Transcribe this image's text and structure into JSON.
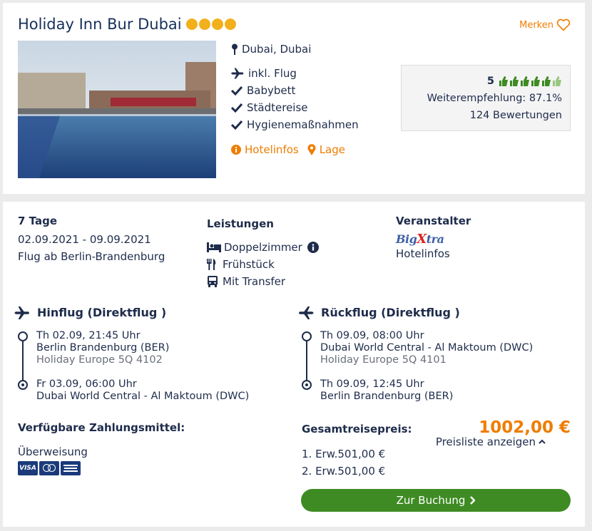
{
  "hotel": {
    "name": "Holiday Inn Bur Dubai",
    "stars": 4,
    "merken": "Merken",
    "location": "Dubai, Dubai",
    "features": [
      "inkl. Flug",
      "Babybett",
      "Städtereise",
      "Hygienemaßnahmen"
    ],
    "links": {
      "hotelinfos": "Hotelinfos",
      "lage": "Lage"
    },
    "rating": {
      "score": "5",
      "thumbs": 6,
      "recommendation": "Weiterempfehlung: 87.1%",
      "reviews": "124 Bewertungen"
    }
  },
  "offer": {
    "duration": "7 Tage",
    "dates": "02.09.2021 - 09.09.2021",
    "departure": "Flug ab Berlin-Brandenburg",
    "services_title": "Leistungen",
    "services": [
      "Doppelzimmer",
      "Frühstück",
      "Mit Transfer"
    ],
    "operator_title": "Veranstalter",
    "operator_logo": "BigXtra",
    "operator_link": "Hotelinfos"
  },
  "outbound": {
    "title": "Hinflug (Direktflug )",
    "dep_time": "Th 02.09, 21:45 Uhr",
    "dep_airport": "Berlin Brandenburg (BER)",
    "flight_no": "Holiday Europe 5Q 4102",
    "arr_time": "Fr 03.09, 06:00 Uhr",
    "arr_airport": "Dubai World Central - Al Maktoum (DWC)"
  },
  "return": {
    "title": "Rückflug (Direktflug )",
    "dep_time": "Th 09.09, 08:00 Uhr",
    "dep_airport": "Dubai World Central - Al Maktoum (DWC)",
    "flight_no": "Holiday Europe 5Q 4101",
    "arr_time": "Th 09.09, 12:45 Uhr",
    "arr_airport": "Berlin Brandenburg (BER)"
  },
  "payment": {
    "title": "Verfügbare Zahlungsmittel:",
    "method": "Überweisung",
    "cards": [
      "VISA",
      "Mastercard",
      "American Express"
    ]
  },
  "pricing": {
    "title": "Gesamtreisepreis:",
    "total": "1002,00 €",
    "list_link": "Preisliste anzeigen",
    "items": [
      "1. Erw.501,00 €",
      "2. Erw.501,00 €"
    ]
  },
  "cta": {
    "label": "Zur Buchung"
  },
  "colors": {
    "navy": "#1e2c4b",
    "orange": "#ef7d00",
    "green": "#3e8b23",
    "star": "#f2b01c"
  }
}
